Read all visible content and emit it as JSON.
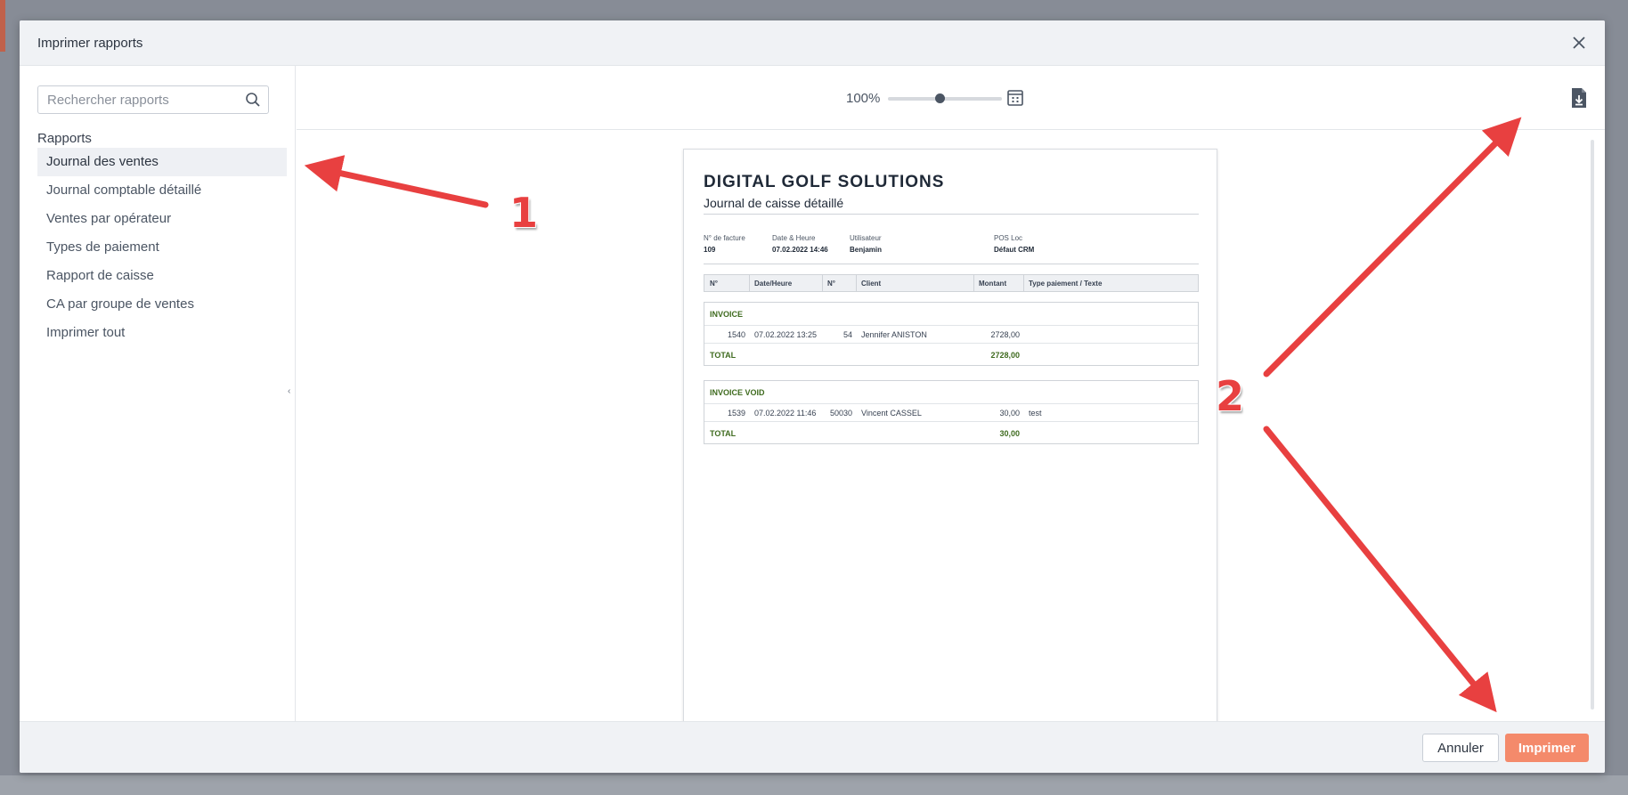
{
  "modal": {
    "title": "Imprimer rapports"
  },
  "sidebar": {
    "search_placeholder": "Rechercher rapports",
    "heading": "Rapports",
    "items": [
      {
        "label": "Journal des ventes",
        "active": true
      },
      {
        "label": "Journal comptable détaillé",
        "active": false
      },
      {
        "label": "Ventes par opérateur",
        "active": false
      },
      {
        "label": "Types de paiement",
        "active": false
      },
      {
        "label": "Rapport de caisse",
        "active": false
      },
      {
        "label": "CA par groupe de ventes",
        "active": false
      },
      {
        "label": "Imprimer tout",
        "active": false
      }
    ]
  },
  "toolbar": {
    "zoom_label": "100%",
    "zoom_level": 0.45
  },
  "document": {
    "company": "DIGITAL GOLF SOLUTIONS",
    "subtitle": "Journal de caisse détaillé",
    "meta": {
      "invoice_label": "N° de facture",
      "invoice_value": "109",
      "datetime_label": "Date & Heure",
      "datetime_value": "07.02.2022 14:46",
      "user_label": "Utilisateur",
      "user_value": "Benjamin",
      "pos_label": "POS Loc",
      "pos_value": "Défaut CRM"
    },
    "columns": [
      "N°",
      "Date/Heure",
      "N°",
      "Client",
      "Montant",
      "Type paiement / Texte"
    ],
    "groups": [
      {
        "title": "INVOICE",
        "rows": [
          {
            "num": "1540",
            "datetime": "07.02.2022 13:25",
            "no": "54",
            "client": "Jennifer ANISTON",
            "amount": "2728,00",
            "text": ""
          }
        ],
        "total_label": "TOTAL",
        "total_value": "2728,00"
      },
      {
        "title": "INVOICE VOID",
        "rows": [
          {
            "num": "1539",
            "datetime": "07.02.2022 11:46",
            "no": "50030",
            "client": "Vincent CASSEL",
            "amount": "30,00",
            "text": "test"
          }
        ],
        "total_label": "TOTAL",
        "total_value": "30,00"
      }
    ]
  },
  "footer": {
    "cancel_label": "Annuler",
    "print_label": "Imprimer"
  },
  "annotations": {
    "callout_1": "1",
    "callout_2": "2",
    "arrow_color": "#e84040"
  },
  "colors": {
    "accent": "#f48a6b",
    "group_title": "#3f6b1f"
  },
  "icons": {
    "search": "search-icon",
    "close": "close-icon",
    "fit": "fit-page-icon",
    "export": "file-download-icon"
  }
}
